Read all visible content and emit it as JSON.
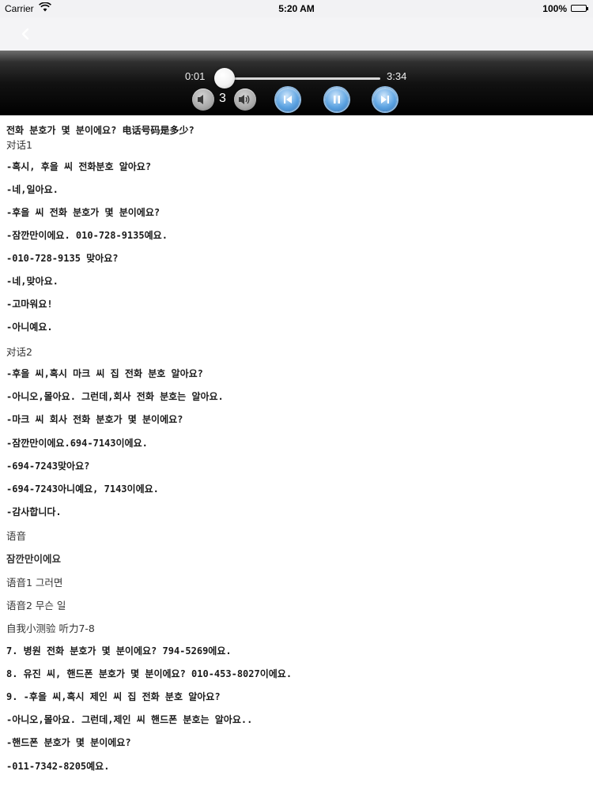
{
  "status_bar": {
    "carrier": "Carrier",
    "time": "5:20 AM",
    "battery": "100%"
  },
  "nav": {
    "back_icon": "chevron-left-icon"
  },
  "player": {
    "elapsed": "0:01",
    "total": "3:34",
    "progress_fraction": 0.005,
    "speed": "3",
    "icons": [
      "volume-down-icon",
      "volume-up-icon",
      "previous-track-icon",
      "pause-icon",
      "next-track-icon"
    ],
    "accent": "#4a90d9"
  },
  "content": {
    "lines": [
      "전화 분호가 몇 분이에요? 电话号码是多少?",
      "对话1",
      "-혹시, 후을 씨 전화분호 알아요?",
      "-네,일아요.",
      "-후을 씨 전화 분호가 몇 분이에요?",
      "-잠깐만이에요. 010-728-9135예요.",
      "-010-728-9135 맞아요?",
      "-네,맞아요.",
      "-고마워요!",
      "-아니예요.",
      "对话2",
      "-후을 씨,혹시 마크 씨 집 전화 분호 알아요?",
      "-아니오,몰아요. 그런데,회사 전화 분호는 알아요.",
      "-마크 씨 회사 전화 분호가 몇 분이에요?",
      "-잠깐만이에요.694-7143이에요.",
      "-694-7243맞아요?",
      "-694-7243아니예요, 7143이에요.",
      "-감사합니다.",
      "语音",
      "잠깐만이에요",
      "语音1 그러면",
      "语音2 무슨 일",
      "自我小测验 听力7-8",
      "7. 병원 전화 분호가 몇 분이에요? 794-5269에요.",
      "8. 유진 씨, 핸드폰 분호가 몇 분이에요? 010-453-8027이에요.",
      "9. -후을 씨,혹시 제인 씨 집 전화 분호 알아요?",
      "-아니오,몰아요. 그런데,제인 씨 핸드폰 분호는 알아요..",
      "-핸드폰 분호가 몇 분이에요?",
      "-011-7342-8205예요."
    ]
  }
}
